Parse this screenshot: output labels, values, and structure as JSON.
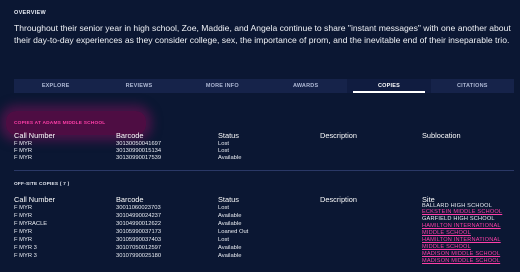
{
  "overview": {
    "label": "OVERVIEW",
    "text": "Throughout their senior year in high school, Zoe, Maddie, and Angela continue to share \"instant messages\" with one another about their day-to-day experiences as they consider college, sex, the importance of prom, and the inevitable end of their inseparable trio."
  },
  "tabs": [
    {
      "label": "EXPLORE"
    },
    {
      "label": "REVIEWS"
    },
    {
      "label": "MORE INFO"
    },
    {
      "label": "AWARDS"
    },
    {
      "label": "COPIES",
      "active": true
    },
    {
      "label": "CITATIONS"
    }
  ],
  "local_copies": {
    "title": "COPIES AT ADAMS MIDDLE SCHOOL",
    "headers": {
      "call_number": "Call Number",
      "barcode": "Barcode",
      "status": "Status",
      "description": "Description",
      "sublocation": "Sublocation"
    },
    "rows": [
      {
        "call_number": "F MYR",
        "barcode": "30130050041697",
        "status": "Lost"
      },
      {
        "call_number": "F MYR",
        "barcode": "30130990015134",
        "status": "Lost"
      },
      {
        "call_number": "F MYR",
        "barcode": "30130990017539",
        "status": "Available"
      }
    ]
  },
  "offsite_copies": {
    "title": "OFF-SITE COPIES ( 7 )",
    "headers": {
      "call_number": "Call Number",
      "barcode": "Barcode",
      "status": "Status",
      "description": "Description",
      "site": "Site"
    },
    "rows": [
      {
        "call_number": "F MYR",
        "barcode": "30011060023703",
        "status": "Lost",
        "site": "BALLARD HIGH SCHOOL"
      },
      {
        "call_number": "F MYR",
        "barcode": "30104990024237",
        "status": "Available",
        "site": "ECKSTEIN MIDDLE SCHOOL"
      },
      {
        "call_number": "F MYRACLE",
        "barcode": "30104990012622",
        "status": "Available",
        "site": "GARFIELD HIGH SCHOOL"
      },
      {
        "call_number": "F MYR",
        "barcode": "30105990037173",
        "status": "Loaned Out",
        "site": "HAMILTON INTERNATIONAL MIDDLE SCHOOL"
      },
      {
        "call_number": "F MYR",
        "barcode": "30105990037403",
        "status": "Lost",
        "site": "HAMILTON INTERNATIONAL MIDDLE SCHOOL"
      },
      {
        "call_number": "F MYR 3",
        "barcode": "30107050012597",
        "status": "Available",
        "site": "MADISON MIDDLE SCHOOL"
      },
      {
        "call_number": "F MYR 3",
        "barcode": "30107990025180",
        "status": "Available",
        "site": "MADISON MIDDLE SCHOOL"
      }
    ]
  },
  "colors": {
    "background": "#0b1733",
    "tab_bar": "#16234a",
    "accent_pink": "#ff3fa8"
  }
}
